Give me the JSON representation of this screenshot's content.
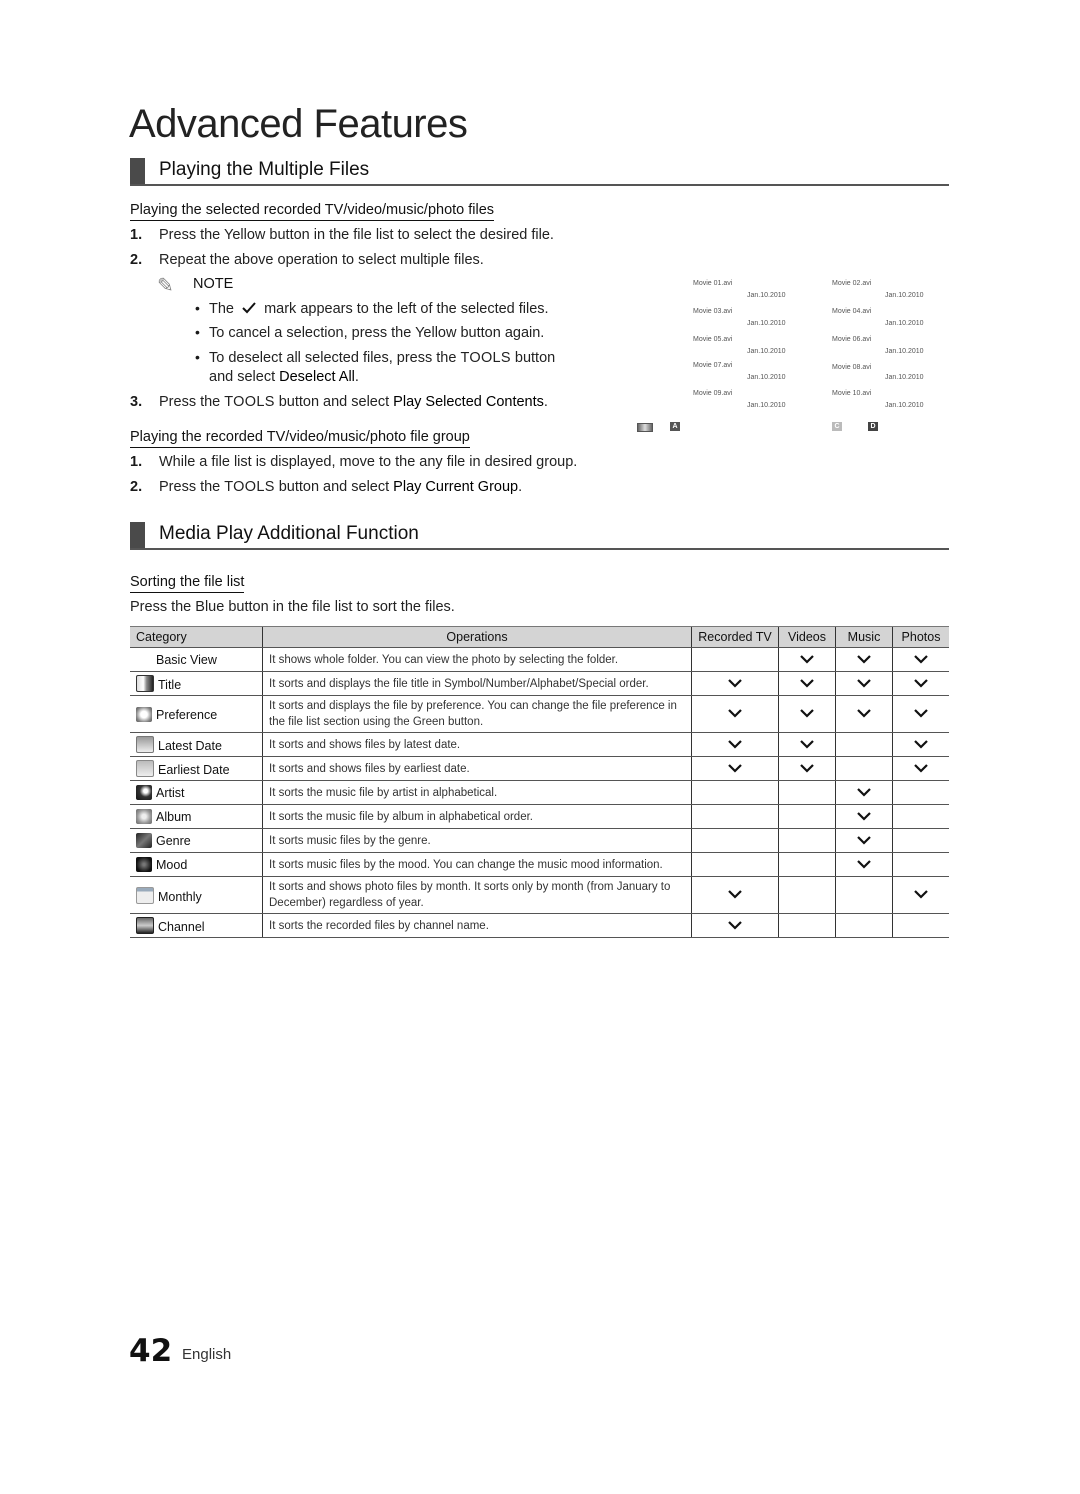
{
  "page": {
    "title": "Advanced Features",
    "page_number": "42",
    "language": "English"
  },
  "section1": {
    "heading": "Playing the Multiple Files",
    "sub1": {
      "heading": "Playing the selected recorded TV/video/music/photo files",
      "steps": [
        {
          "num": "1.",
          "text": "Press the Yellow button in the file list to select the desired file."
        },
        {
          "num": "2.",
          "text": "Repeat the above operation to select multiple files."
        }
      ],
      "note_label": "NOTE",
      "notes": [
        {
          "before": "The",
          "after": "mark appears to the left of the selected files."
        },
        {
          "text": "To cancel a selection, press the Yellow button again."
        },
        {
          "line1_a": "To deselect all selected files, press the ",
          "line1_tools": "TOOLS",
          "line1_b": " button",
          "line2_a": "and select ",
          "line2_bold": "Deselect All",
          "line2_b": "."
        }
      ],
      "step3": {
        "num": "3.",
        "a": "Press the ",
        "tools": "TOOLS",
        "b": " button and select ",
        "bold": "Play Selected Contents",
        "c": "."
      }
    },
    "sub2": {
      "heading": "Playing the recorded TV/video/music/photo file group",
      "steps": [
        {
          "num": "1.",
          "text": "While a file list is displayed, move to the any file in desired group."
        },
        {
          "num": "2.",
          "a": "Press the ",
          "tools": "TOOLS",
          "b": " button and select ",
          "bold": "Play Current Group",
          "c": "."
        }
      ]
    },
    "file_list_screen": {
      "files": [
        {
          "name": "Movie 01.avi",
          "date": "Jan.10.2010"
        },
        {
          "name": "Movie 02.avi",
          "date": "Jan.10.2010"
        },
        {
          "name": "Movie 03.avi",
          "date": "Jan.10.2010"
        },
        {
          "name": "Movie 04.avi",
          "date": "Jan.10.2010"
        },
        {
          "name": "Movie 05.avi",
          "date": "Jan.10.2010"
        },
        {
          "name": "Movie 06.avi",
          "date": "Jan.10.2010"
        },
        {
          "name": "Movie 07.avi",
          "date": "Jan.10.2010"
        },
        {
          "name": "Movie 08.avi",
          "date": "Jan.10.2010"
        },
        {
          "name": "Movie 09.avi",
          "date": "Jan.10.2010"
        },
        {
          "name": "Movie 10.avi",
          "date": "Jan.10.2010"
        }
      ],
      "keys": [
        {
          "icon": "device-icon",
          "label": ""
        },
        {
          "label": "A",
          "color": "#555555"
        },
        {
          "label": "C",
          "color": "#bbbbbb"
        },
        {
          "label": "D",
          "color": "#444444"
        }
      ]
    }
  },
  "section2": {
    "heading": "Media Play Additional Function",
    "sub": {
      "heading": "Sorting the file list",
      "text": "Press the Blue button in the file list to sort the files."
    },
    "table": {
      "headers": [
        "Category",
        "Operations",
        "Recorded TV",
        "Videos",
        "Music",
        "Photos"
      ],
      "rows": [
        {
          "category": "Basic View",
          "icon": "",
          "operation": "It shows whole folder. You can view the photo by selecting the folder.",
          "recorded_tv": false,
          "videos": true,
          "music": true,
          "photos": true
        },
        {
          "category": "Title",
          "icon": "title-icon",
          "operation": "It sorts and displays the file title in Symbol/Number/Alphabet/Special order.",
          "recorded_tv": true,
          "videos": true,
          "music": true,
          "photos": true
        },
        {
          "category": "Preference",
          "icon": "preference-star-icon",
          "operation": "It sorts and displays the file by preference. You can change the file preference in the file list section using the Green button.",
          "recorded_tv": true,
          "videos": true,
          "music": true,
          "photos": true
        },
        {
          "category": "Latest Date",
          "icon": "latest-date-calendar-icon",
          "operation": "It sorts and shows files by latest date.",
          "recorded_tv": true,
          "videos": true,
          "music": false,
          "photos": true
        },
        {
          "category": "Earliest Date",
          "icon": "earliest-date-calendar-icon",
          "operation": "It sorts and shows files by earliest date.",
          "recorded_tv": true,
          "videos": true,
          "music": false,
          "photos": true
        },
        {
          "category": "Artist",
          "icon": "artist-icon",
          "operation": "It sorts the music file by artist in alphabetical.",
          "recorded_tv": false,
          "videos": false,
          "music": true,
          "photos": false
        },
        {
          "category": "Album",
          "icon": "album-icon",
          "operation": "It sorts the music file by album in alphabetical order.",
          "recorded_tv": false,
          "videos": false,
          "music": true,
          "photos": false
        },
        {
          "category": "Genre",
          "icon": "genre-guitar-icon",
          "operation": "It sorts music files by the genre.",
          "recorded_tv": false,
          "videos": false,
          "music": true,
          "photos": false
        },
        {
          "category": "Mood",
          "icon": "mood-icon",
          "operation": "It sorts music files by the mood. You can change the music mood information.",
          "recorded_tv": false,
          "videos": false,
          "music": true,
          "photos": false
        },
        {
          "category": "Monthly",
          "icon": "monthly-calendar-icon",
          "operation": "It sorts and shows photo files by month. It sorts only by month (from January to December) regardless of year.",
          "recorded_tv": true,
          "videos": false,
          "music": false,
          "photos": true
        },
        {
          "category": "Channel",
          "icon": "channel-icon",
          "operation": "It sorts the recorded files by channel name.",
          "recorded_tv": true,
          "videos": false,
          "music": false,
          "photos": false
        }
      ]
    }
  }
}
